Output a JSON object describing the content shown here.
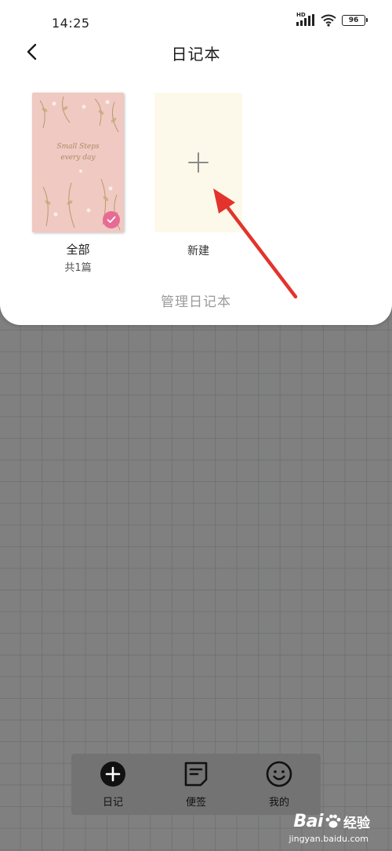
{
  "status_bar": {
    "time": "14:25",
    "network_badge": "HD",
    "battery_level": "96"
  },
  "header": {
    "title": "日记本",
    "back_icon": "chevron-left-icon"
  },
  "notebooks": [
    {
      "name": "全部",
      "count": "共1篇",
      "cover_text_line1": "Small Steps",
      "cover_text_line2": "every day",
      "cover_color": "#efc9c2",
      "selected": true,
      "badge_color": "#e76b94"
    }
  ],
  "new_notebook": {
    "label": "新建",
    "icon": "plus-icon",
    "color": "#fdf9ea"
  },
  "manage_label": "管理日记本",
  "annotation": {
    "arrow_color": "#e2342c"
  },
  "bottom_nav": {
    "items": [
      {
        "label": "日记",
        "icon": "add-circle-icon"
      },
      {
        "label": "便签",
        "icon": "note-icon"
      },
      {
        "label": "我的",
        "icon": "smiley-icon"
      }
    ]
  },
  "watermark": {
    "brand": "Bai",
    "brand_suffix": "经验",
    "url": "jingyan.baidu.com"
  }
}
